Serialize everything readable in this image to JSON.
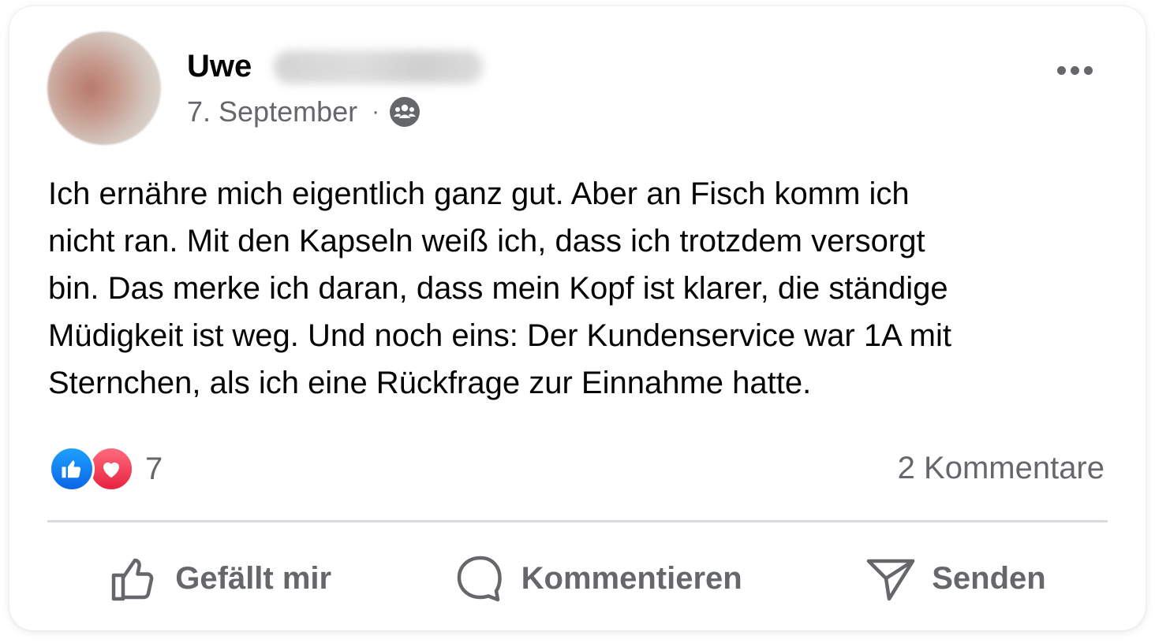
{
  "post": {
    "author_first_name": "Uwe",
    "date": "7. September",
    "separator": "·",
    "privacy_icon": "group-icon",
    "more_icon": "more-options-icon",
    "text": "Ich ernähre mich eigentlich ganz gut. Aber an Fisch komm ich\nnicht ran. Mit den Kapseln weiß ich, dass ich trotzdem versorgt\nbin. Das merke ich daran, dass mein Kopf ist klarer, die ständige\nMüdigkeit ist weg. Und noch eins: Der Kundenservice war 1A mit\nSternchen, als ich eine Rückfrage zur Einnahme hatte."
  },
  "stats": {
    "reaction_icons": [
      "like-icon",
      "love-icon"
    ],
    "reaction_count": "7",
    "comments_label": "2 Kommentare"
  },
  "actions": {
    "like_label": "Gefällt mir",
    "comment_label": "Kommentieren",
    "send_label": "Senden"
  },
  "colors": {
    "text_primary": "#050505",
    "text_secondary": "#65676b",
    "like_blue": "#0a66e6",
    "love_red": "#e8223f",
    "divider": "#d9dadd"
  }
}
